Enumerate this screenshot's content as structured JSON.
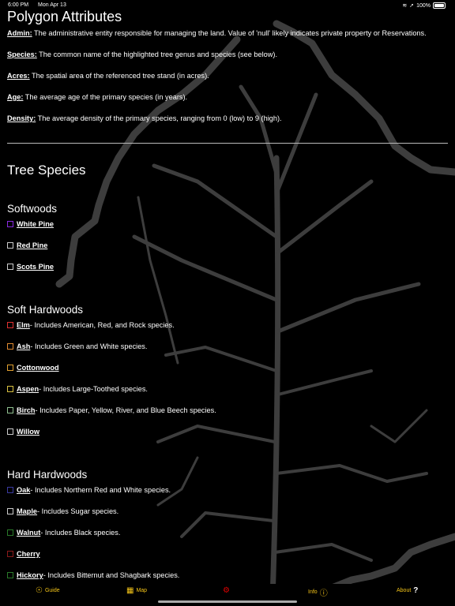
{
  "status": {
    "time": "6:00 PM",
    "date": "Mon Apr 13",
    "battery": "100%"
  },
  "title": "Polygon Attributes",
  "attributes": [
    {
      "term": "Admin:",
      "desc": " The administrative entity responsible for managing the land. Value of 'null' likely indicates private property or Reservations."
    },
    {
      "term": "Species:",
      "desc": " The common name of the highlighted tree genus and species (see below)."
    },
    {
      "term": "Acres:",
      "desc": " The spatial area of the referenced tree stand (in acres)."
    },
    {
      "term": "Age:",
      "desc": " The average age of the primary species (in years)."
    },
    {
      "term": "Density:",
      "desc": " The average density of the primary species, ranging from 0 (low) to 9 (high)."
    }
  ],
  "tree_species_title": "Tree Species",
  "groups": [
    {
      "title": "Softwoods",
      "items": [
        {
          "name": "White Pine",
          "desc": "",
          "color": "#8a2be2"
        },
        {
          "name": "Red Pine",
          "desc": "",
          "color": "#cccccc"
        },
        {
          "name": "Scots Pine",
          "desc": "",
          "color": "#cccccc"
        }
      ]
    },
    {
      "title": "Soft Hardwoods",
      "items": [
        {
          "name": "Elm",
          "desc": " - Includes American, Red, and Rock species.",
          "color": "#e03030"
        },
        {
          "name": "Ash",
          "desc": " - Includes Green and White species.",
          "color": "#e08a30"
        },
        {
          "name": "Cottonwood",
          "desc": "",
          "color": "#e0a030"
        },
        {
          "name": "Aspen",
          "desc": " - Includes Large-Toothed species.",
          "color": "#d8c040"
        },
        {
          "name": "Birch",
          "desc": " - Includes Paper, Yellow, River, and Blue Beech species.",
          "color": "#90c090"
        },
        {
          "name": "Willow",
          "desc": "",
          "color": "#cccccc"
        }
      ]
    },
    {
      "title": "Hard Hardwoods",
      "items": [
        {
          "name": "Oak",
          "desc": " - Includes Northern Red and White species.",
          "color": "#3a3aa0"
        },
        {
          "name": "Maple",
          "desc": " - Includes Sugar species.",
          "color": "#cccccc"
        },
        {
          "name": "Walnut",
          "desc": " - Includes Black species.",
          "color": "#2a7a2a"
        },
        {
          "name": "Cherry",
          "desc": "",
          "color": "#8b1a1a"
        },
        {
          "name": "Hickory",
          "desc": " - Includes Bitternut and Shagbark species.",
          "color": "#2a7a2a"
        }
      ]
    }
  ],
  "tabs": [
    {
      "label": "Guide",
      "icon": "compass-icon",
      "glyph": "☉"
    },
    {
      "label": "Map",
      "icon": "map-icon",
      "glyph": "▦"
    },
    {
      "label": "",
      "icon": "gear-icon",
      "glyph": "⚙"
    },
    {
      "label": "Info",
      "icon": "info-icon",
      "glyph": "ⓘ"
    },
    {
      "label": "About",
      "icon": "question-icon",
      "glyph": "?"
    }
  ],
  "colors": {
    "accent": "#f5c518",
    "active_tab": "#e00000",
    "background": "#000000"
  }
}
